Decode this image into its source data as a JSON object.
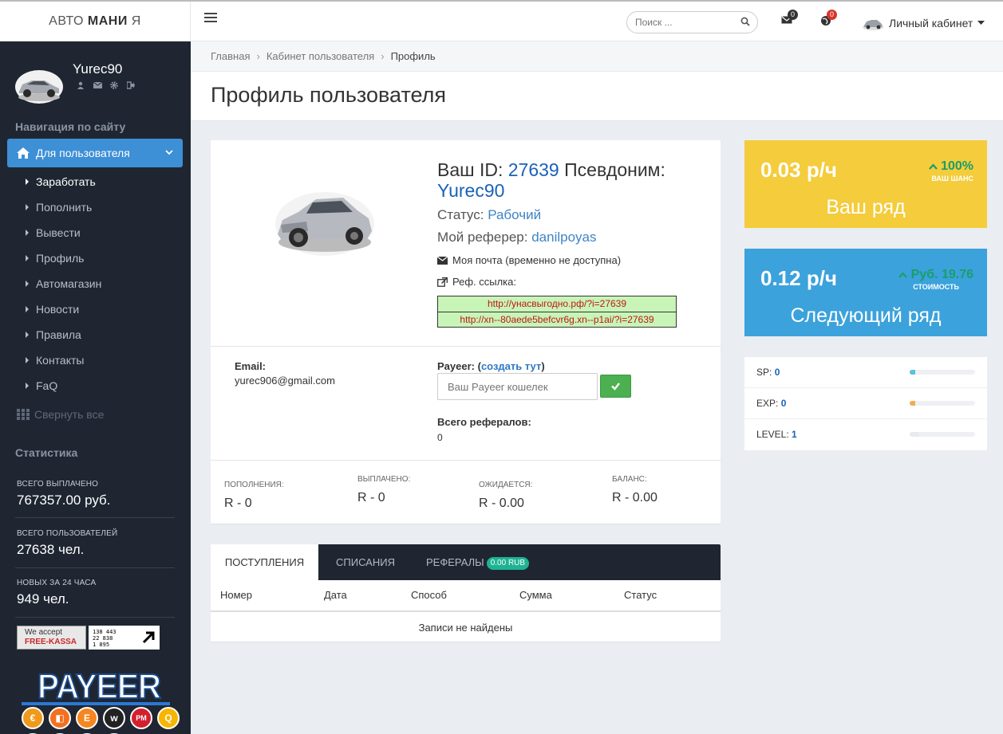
{
  "header": {
    "logo_light": "АВТО ",
    "logo_bold": "МАНИ",
    "logo_tail": " Я",
    "search_placeholder": "Поиск ...",
    "mail_count": "0",
    "notif_count": "0",
    "cabinet_label": "Личный кабинет"
  },
  "sidebar": {
    "username": "Yurec90",
    "nav_title": "Навигация по сайту",
    "active_group": "Для пользователя",
    "items": [
      {
        "label": "Заработать"
      },
      {
        "label": "Пополнить"
      },
      {
        "label": "Вывести"
      },
      {
        "label": "Профиль"
      },
      {
        "label": "Автомагазин"
      },
      {
        "label": "Новости"
      },
      {
        "label": "Правила"
      },
      {
        "label": "Контакты"
      },
      {
        "label": "FaQ"
      }
    ],
    "collapse_label": "Свернуть все",
    "stats_title": "Статистика",
    "stats": [
      {
        "label": "Всего выплачено",
        "value": "767357.00 руб."
      },
      {
        "label": "Всего пользователей",
        "value": "27638 чел."
      },
      {
        "label": "Новых за 24 часа",
        "value": "949 чел."
      }
    ],
    "freekassa_line1": "We accept",
    "freekassa_line2": "FREE-KASSA",
    "counter_lines": [
      "138 443",
      "22 838",
      "1 895"
    ],
    "payeer_logo": "PAYEER"
  },
  "breadcrumb": [
    "Главная",
    "Кабинет пользователя",
    "Профиль"
  ],
  "page_title": "Профиль пользователя",
  "profile": {
    "id_label": "Ваш ID:",
    "id_value": "27639",
    "nick_label": "Псевдоним:",
    "nick_value": "Yurec90",
    "status_label": "Статус:",
    "status_value": "Рабочий",
    "referrer_label": "Мой реферер:",
    "referrer_value": "danilpoyas",
    "mail_text": "Моя почта (временно не доступна)",
    "ref_label": "Реф. ссылка:",
    "ref_links": [
      "http://унасвыгодно.рф/?i=27639",
      "http://xn--80aede5befcvr6g.xn--p1ai/?i=27639"
    ],
    "email_label": "Email:",
    "email_value": "yurec906@gmail.com",
    "payeer_label": "Payeer:",
    "payeer_link": "создать тут",
    "wallet_placeholder": "Ваш Payeer кошелек",
    "refs_label": "Всего рефералов:",
    "refs_value": "0",
    "money": [
      {
        "label": "Пополнения:",
        "value": "R - 0"
      },
      {
        "label": "Выплачено:",
        "value": "R - 0"
      },
      {
        "label": "Ожидается:",
        "value": "R - 0.00"
      },
      {
        "label": "Баланс:",
        "value": "R - 0.00"
      }
    ]
  },
  "tabs": {
    "items": [
      "Поступления",
      "Списания",
      "Рефералы"
    ],
    "ref_badge": "0.00 RUB",
    "columns": [
      "Номер",
      "Дата",
      "Способ",
      "Сумма",
      "Статус"
    ],
    "empty_text": "Записи не найдены"
  },
  "widgets": {
    "current": {
      "rate": "0.03 р/ч",
      "chance": "100%",
      "chance_label": "ВАШ ШАНС",
      "title": "Ваш ряд"
    },
    "next": {
      "rate": "0.12 р/ч",
      "cost": "Руб. 19.76",
      "cost_label": "СТОИМОСТЬ",
      "title": "Следующий ряд"
    }
  },
  "levels": [
    {
      "label": "SP:",
      "value": "0",
      "progress": 0.08,
      "color": "#5bc0de"
    },
    {
      "label": "EXP:",
      "value": "0",
      "progress": 0.08,
      "color": "#f0ad4e"
    },
    {
      "label": "LEVEL:",
      "value": "1",
      "progress": 0.15,
      "color": "#e8eaee"
    }
  ],
  "colors": {
    "accent": "#3d8fd6",
    "sidebar": "#1f2632",
    "yellow": "#f4cc3c",
    "blue": "#3ba2dc",
    "green": "#4cb050"
  }
}
